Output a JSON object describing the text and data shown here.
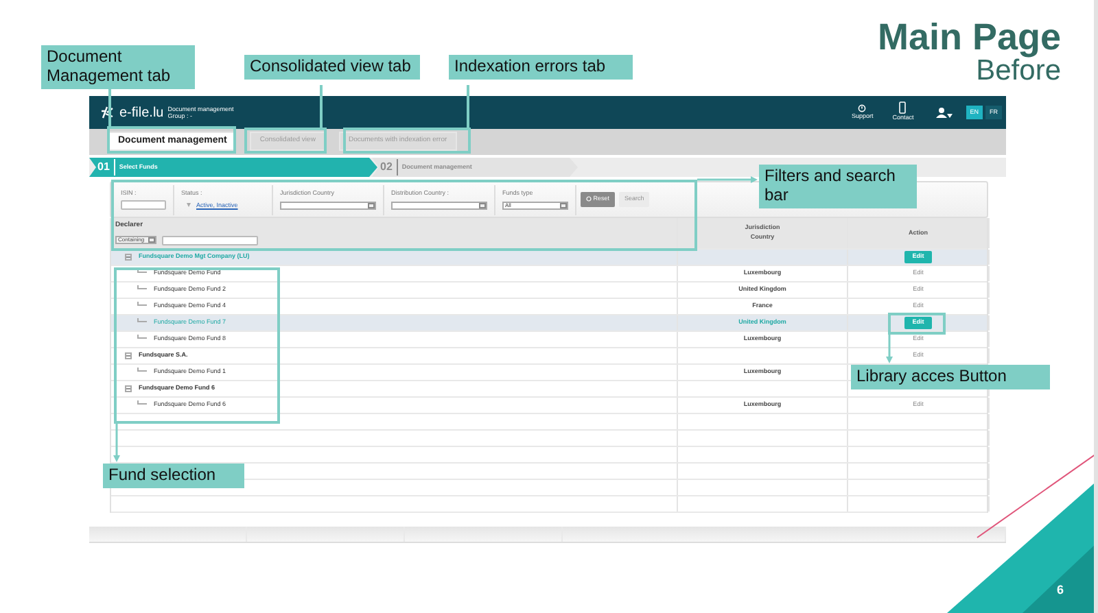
{
  "slide": {
    "title": "Main Page",
    "subtitle": "Before",
    "page_number": "6"
  },
  "app": {
    "brand": "e-file.lu",
    "brand_subtitle": "Document management",
    "group": "Group : -",
    "header_links": [
      {
        "label": "Support",
        "kind": "support"
      },
      {
        "label": "Contact",
        "kind": "contact"
      }
    ],
    "languages": [
      {
        "label": "EN",
        "selected": true
      },
      {
        "label": "FR",
        "selected": false
      }
    ],
    "tabs": [
      {
        "label": "Document management",
        "selected": true
      },
      {
        "label": "Consolidated view",
        "selected": false
      },
      {
        "label": "Documents with indexation error",
        "selected": false
      }
    ],
    "steps": [
      {
        "number": "01",
        "label": "Select Funds",
        "selected": true
      },
      {
        "number": "02",
        "label": "Document management",
        "selected": false
      }
    ],
    "filters": [
      {
        "kind": "input",
        "label": "ISIN :"
      },
      {
        "kind": "link",
        "label": "Status :",
        "value": "Active, Inactive"
      },
      {
        "kind": "select",
        "label": "Jurisdiction Country"
      },
      {
        "kind": "select",
        "label": "Distribution Country :"
      },
      {
        "kind": "select",
        "label": "Funds type",
        "value": "All"
      }
    ],
    "filter_buttons": [
      {
        "label": "Reset",
        "disabled": false
      },
      {
        "label": "Search",
        "disabled": true
      }
    ],
    "table": {
      "declarer": {
        "label": "Declarer",
        "operator": "Containing"
      },
      "column_headers": [
        "Jurisdiction Country",
        "Action"
      ],
      "rows": [
        {
          "name": "Fundsquare Demo Mgt Company (LU)",
          "selected": true,
          "expanded": true,
          "action": {
            "label": "Edit",
            "kind": "button"
          },
          "children": [
            {
              "name": "Fundsquare Demo Fund",
              "jurisdiction": "Luxembourg",
              "selected": false,
              "action": {
                "label": "Edit",
                "kind": "link"
              }
            },
            {
              "name": "Fundsquare Demo Fund 2",
              "jurisdiction": "United Kingdom",
              "selected": false,
              "action": {
                "label": "Edit",
                "kind": "link"
              }
            },
            {
              "name": "Fundsquare Demo Fund 4",
              "jurisdiction": "France",
              "selected": false,
              "action": {
                "label": "Edit",
                "kind": "link"
              }
            },
            {
              "name": "Fundsquare Demo Fund 7",
              "jurisdiction": "United Kingdom",
              "selected": true,
              "action": {
                "label": "Edit",
                "kind": "button"
              }
            },
            {
              "name": "Fundsquare Demo Fund 8",
              "jurisdiction": "Luxembourg",
              "selected": false,
              "action": {
                "label": "Edit",
                "kind": "link"
              }
            }
          ]
        },
        {
          "name": "Fundsquare S.A.",
          "selected": false,
          "expanded": true,
          "action": {
            "label": "Edit",
            "kind": "link"
          },
          "children": [
            {
              "name": "Fundsquare Demo Fund 1",
              "jurisdiction": "Luxembourg",
              "selected": false
            }
          ]
        },
        {
          "name": "Fundsquare Demo Fund 6",
          "selected": false,
          "expanded": true,
          "children": [
            {
              "name": "Fundsquare Demo Fund 6",
              "jurisdiction": "Luxembourg",
              "selected": false,
              "action": {
                "label": "Edit",
                "kind": "link"
              }
            }
          ]
        }
      ]
    }
  },
  "annotations": [
    {
      "text": "Document Management tab"
    },
    {
      "text": "Consolidated view tab"
    },
    {
      "text": "Indexation errors tab"
    },
    {
      "text": "Filters and search bar"
    },
    {
      "text": "Library acces Button"
    },
    {
      "text": "Fund selection"
    }
  ]
}
